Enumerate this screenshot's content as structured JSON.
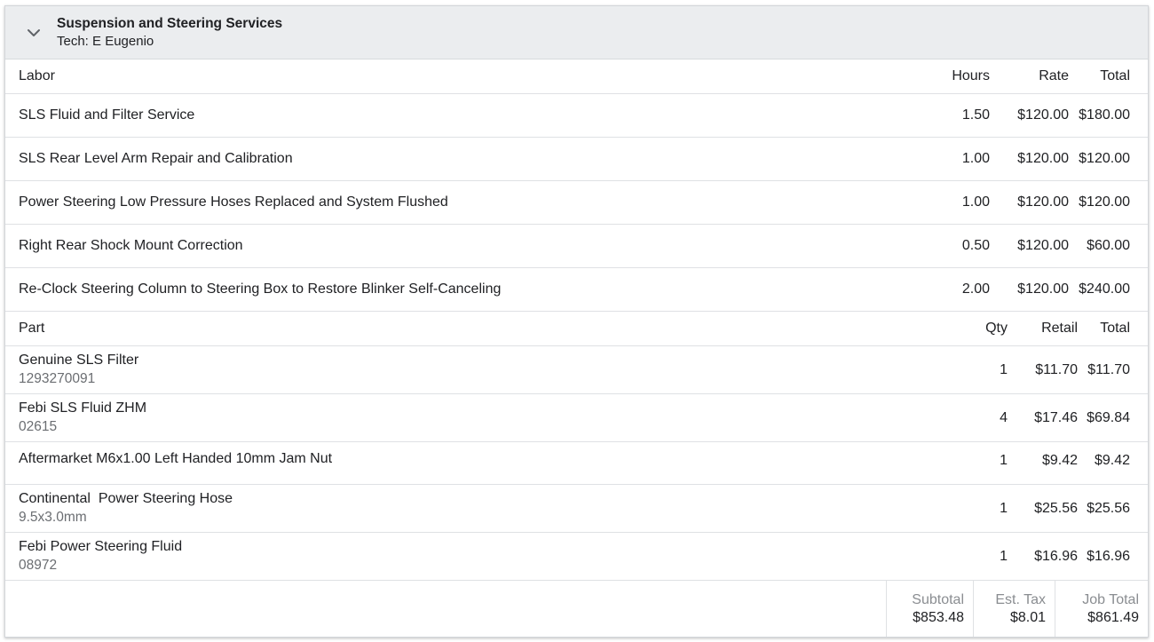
{
  "job": {
    "title": "Suspension and Steering Services",
    "tech_label": "Tech: E Eugenio",
    "toggle_icon": "chevron-down-icon"
  },
  "labor": {
    "headers": {
      "name": "Labor",
      "hours": "Hours",
      "rate": "Rate",
      "total": "Total"
    },
    "rows": [
      {
        "name": "SLS Fluid and Filter Service",
        "hours": "1.50",
        "rate": "$120.00",
        "total": "$180.00"
      },
      {
        "name": "SLS Rear Level Arm Repair and Calibration",
        "hours": "1.00",
        "rate": "$120.00",
        "total": "$120.00"
      },
      {
        "name": "Power Steering Low Pressure Hoses Replaced and System Flushed",
        "hours": "1.00",
        "rate": "$120.00",
        "total": "$120.00"
      },
      {
        "name": "Right Rear Shock Mount Correction",
        "hours": "0.50",
        "rate": "$120.00",
        "total": "$60.00"
      },
      {
        "name": "Re-Clock Steering Column to Steering Box to Restore Blinker Self-Canceling",
        "hours": "2.00",
        "rate": "$120.00",
        "total": "$240.00"
      }
    ]
  },
  "parts": {
    "headers": {
      "name": "Part",
      "qty": "Qty",
      "retail": "Retail",
      "total": "Total"
    },
    "rows": [
      {
        "name": "Genuine SLS Filter",
        "number": "1293270091",
        "qty": "1",
        "retail": "$11.70",
        "total": "$11.70"
      },
      {
        "name": "Febi SLS Fluid ZHM",
        "number": "02615",
        "qty": "4",
        "retail": "$17.46",
        "total": "$69.84"
      },
      {
        "name": "Aftermarket M6x1.00 Left Handed 10mm Jam Nut",
        "number": "",
        "qty": "1",
        "retail": "$9.42",
        "total": "$9.42"
      },
      {
        "name": "Continental  Power Steering Hose",
        "number": "9.5x3.0mm",
        "qty": "1",
        "retail": "$25.56",
        "total": "$25.56"
      },
      {
        "name": "Febi Power Steering Fluid",
        "number": "08972",
        "qty": "1",
        "retail": "$16.96",
        "total": "$16.96"
      }
    ]
  },
  "totals": {
    "subtotal_label": "Subtotal",
    "subtotal": "$853.48",
    "tax_label": "Est. Tax",
    "tax": "$8.01",
    "job_total_label": "Job Total",
    "job_total": "$861.49"
  }
}
